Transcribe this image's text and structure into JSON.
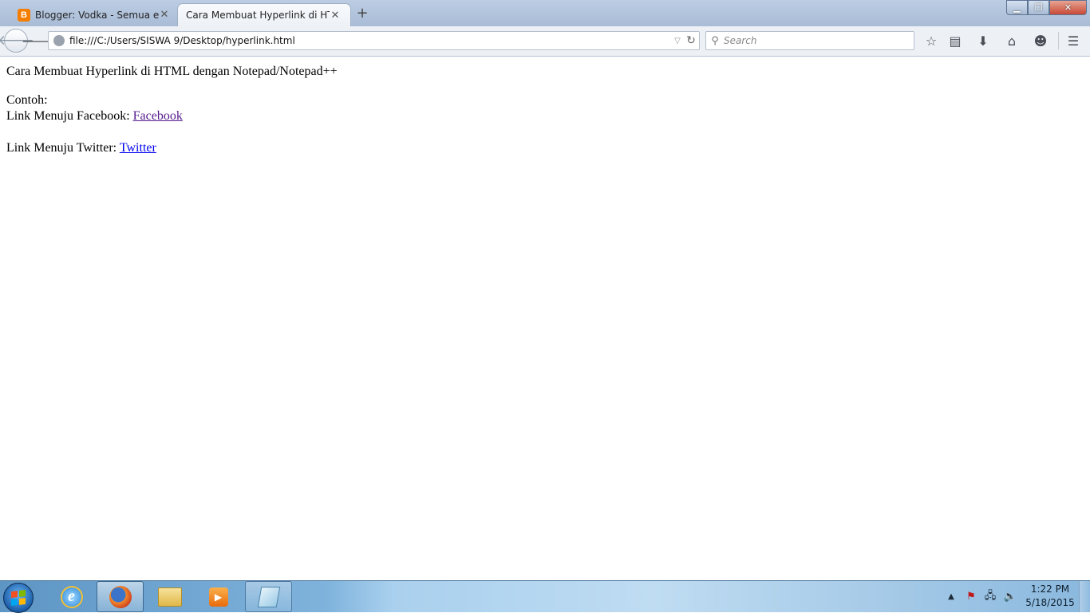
{
  "browser": {
    "tabs": [
      {
        "label": "Blogger: Vodka - Semua en...",
        "favicon": "blogger-icon",
        "active": false
      },
      {
        "label": "Cara Membuat Hyperlink di HT...",
        "active": true
      }
    ],
    "tab_close_glyph": "✕",
    "new_tab_glyph": "+",
    "url": "file:///C:/Users/SISWA 9/Desktop/hyperlink.html",
    "search_placeholder": "Search",
    "toolbar_icons": [
      "bookmark-star-icon",
      "reading-list-icon",
      "download-icon",
      "home-icon",
      "hello-chat-icon",
      "menu-icon"
    ]
  },
  "page": {
    "heading": "Cara Membuat Hyperlink di HTML dengan Notepad/Notepad++",
    "example_label": "Contoh:",
    "facebook_prefix": "Link Menuju Facebook:",
    "facebook_link": "Facebook",
    "twitter_prefix": "Link Menuju Twitter:",
    "twitter_link": "Twitter"
  },
  "taskbar": {
    "pinned": [
      "internet-explorer-icon",
      "firefox-icon",
      "file-explorer-icon",
      "media-player-icon",
      "notepad-icon"
    ],
    "active_app": "firefox-icon",
    "time": "1:22 PM",
    "date": "5/18/2015"
  },
  "colors": {
    "visited_link": "#551a8b",
    "unvisited_link": "#0000ee",
    "blogger_orange": "#f57d00"
  }
}
